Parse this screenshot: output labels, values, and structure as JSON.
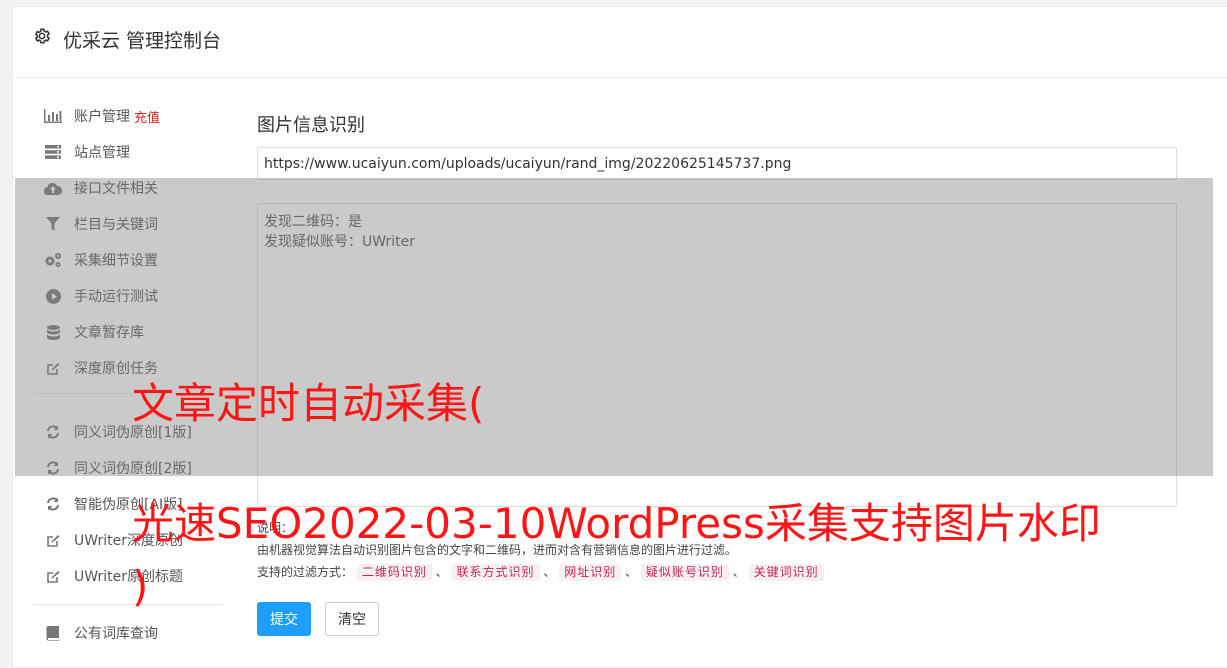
{
  "header": {
    "title": "优采云 管理控制台",
    "icon": "gear-icon"
  },
  "sidebar": {
    "items": [
      {
        "label": "账户管理",
        "badge": "充值",
        "icon": "bar-chart-icon"
      },
      {
        "label": "站点管理",
        "icon": "server-icon"
      },
      {
        "label": "接口文件相关",
        "icon": "cloud-upload-icon"
      },
      {
        "label": "栏目与关键词",
        "icon": "filter-icon"
      },
      {
        "label": "采集细节设置",
        "icon": "cogs-icon"
      },
      {
        "label": "手动运行测试",
        "icon": "play-circle-icon"
      },
      {
        "label": "文章暂存库",
        "icon": "database-icon"
      },
      {
        "label": "深度原创任务",
        "icon": "edit-icon"
      },
      {
        "label": "同义词伪原创[1版]",
        "icon": "refresh-icon"
      },
      {
        "label": "同义词伪原创[2版]",
        "icon": "refresh-icon"
      },
      {
        "label": "智能伪原创[AI版]",
        "icon": "refresh-icon"
      },
      {
        "label": "UWriter深度原创",
        "icon": "edit-icon"
      },
      {
        "label": "UWriter原创标题",
        "icon": "edit-icon"
      },
      {
        "label": "公有词库查询",
        "icon": "book-icon"
      }
    ]
  },
  "main": {
    "title": "图片信息识别",
    "url_value": "https://www.ucaiyun.com/uploads/ucaiyun/rand_img/20220625145737.png",
    "result_lines": [
      "发现二维码：是",
      "发现疑似账号：UWriter"
    ],
    "desc_label": "说明：",
    "desc_text": "由机器视觉算法自动识别图片包含的文字和二维码，进而对含有营销信息的图片进行过滤。",
    "filter_label": "支持的过滤方式：",
    "filters": [
      "二维码识别",
      "联系方式识别",
      "网址识别",
      "疑似账号识别",
      "关键词识别"
    ],
    "filter_sep": "、",
    "submit_label": "提交",
    "clear_label": "清空"
  },
  "overlay": {
    "line1": "文章定时自动采集(",
    "line2": "光速SEO2022-03-10WordPress采集支持图片水印",
    "line3": ")"
  },
  "colors": {
    "primary": "#1e9fff",
    "badge": "#e02020",
    "overlay_text": "#ff1515",
    "tag_text": "#c7254e"
  }
}
